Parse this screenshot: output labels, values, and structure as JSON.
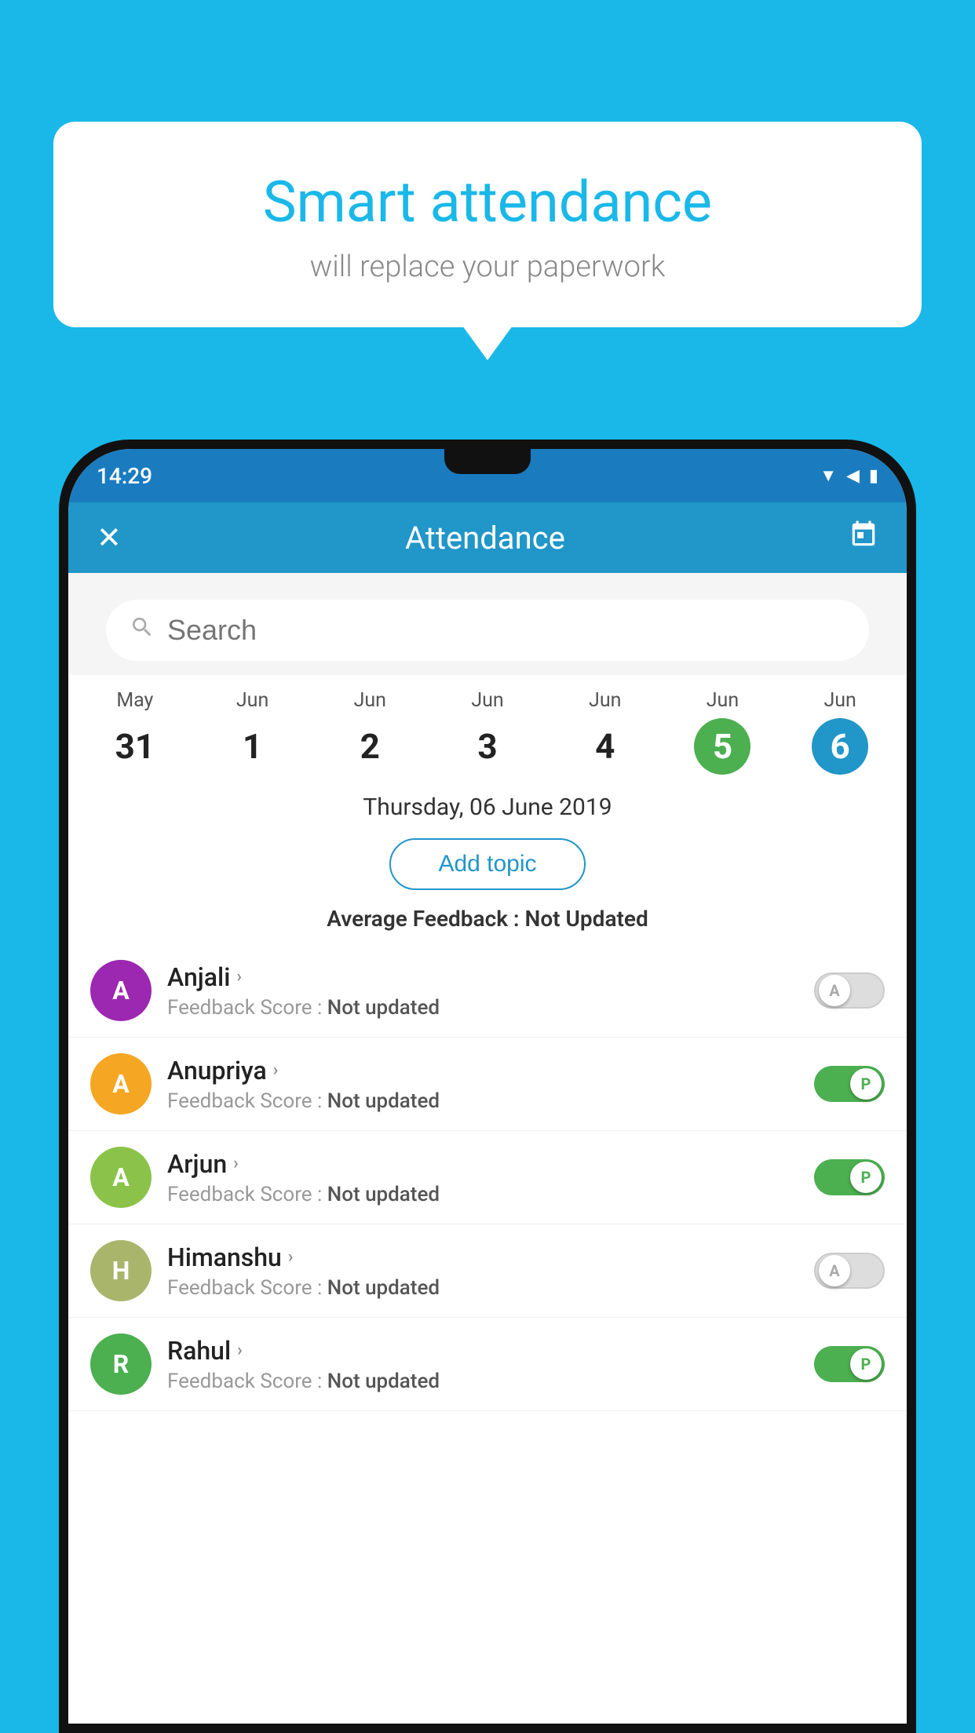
{
  "background_color": "#1ab8e8",
  "speech_bubble": {
    "title": "Smart attendance",
    "subtitle": "will replace your paperwork"
  },
  "status_bar": {
    "time": "14:29",
    "wifi": "▼",
    "signal": "◀",
    "battery": "▮"
  },
  "header": {
    "title": "Attendance",
    "close_label": "✕",
    "calendar_icon": "📅"
  },
  "search": {
    "placeholder": "Search"
  },
  "calendar": {
    "days": [
      {
        "month": "May",
        "date": "31",
        "highlight": ""
      },
      {
        "month": "Jun",
        "date": "1",
        "highlight": ""
      },
      {
        "month": "Jun",
        "date": "2",
        "highlight": ""
      },
      {
        "month": "Jun",
        "date": "3",
        "highlight": ""
      },
      {
        "month": "Jun",
        "date": "4",
        "highlight": ""
      },
      {
        "month": "Jun",
        "date": "5",
        "highlight": "today"
      },
      {
        "month": "Jun",
        "date": "6",
        "highlight": "selected"
      }
    ]
  },
  "selected_date": "Thursday, 06 June 2019",
  "add_topic_label": "Add topic",
  "avg_feedback_label": "Average Feedback :",
  "avg_feedback_value": "Not Updated",
  "students": [
    {
      "name": "Anjali",
      "avatar_letter": "A",
      "avatar_color": "#9c27b0",
      "feedback_label": "Feedback Score :",
      "feedback_value": "Not updated",
      "toggle": "off",
      "toggle_letter": "A"
    },
    {
      "name": "Anupriya",
      "avatar_letter": "A",
      "avatar_color": "#f5a623",
      "feedback_label": "Feedback Score :",
      "feedback_value": "Not updated",
      "toggle": "on",
      "toggle_letter": "P"
    },
    {
      "name": "Arjun",
      "avatar_letter": "A",
      "avatar_color": "#8bc34a",
      "feedback_label": "Feedback Score :",
      "feedback_value": "Not updated",
      "toggle": "on",
      "toggle_letter": "P"
    },
    {
      "name": "Himanshu",
      "avatar_letter": "H",
      "avatar_color": "#aab56c",
      "feedback_label": "Feedback Score :",
      "feedback_value": "Not updated",
      "toggle": "off",
      "toggle_letter": "A"
    },
    {
      "name": "Rahul",
      "avatar_letter": "R",
      "avatar_color": "#4caf50",
      "feedback_label": "Feedback Score :",
      "feedback_value": "Not updated",
      "toggle": "on",
      "toggle_letter": "P"
    }
  ]
}
